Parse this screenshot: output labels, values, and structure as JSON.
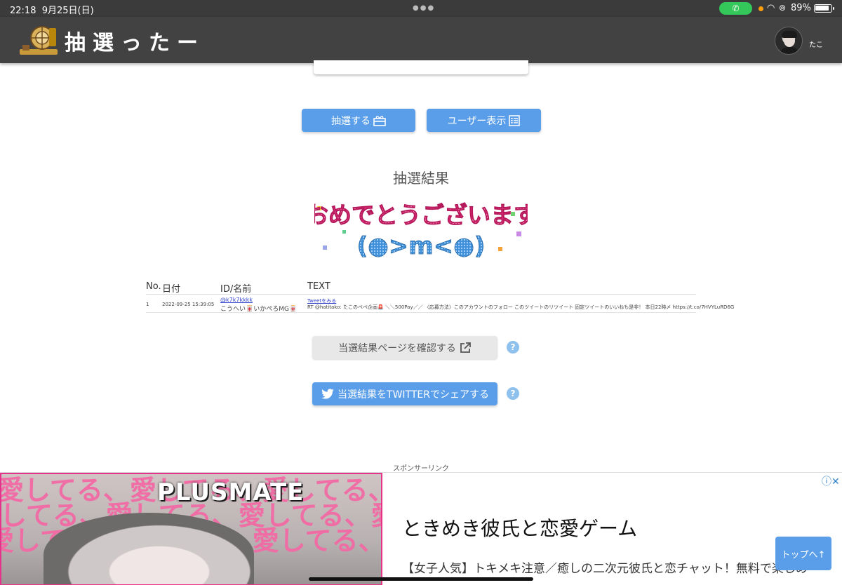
{
  "status_bar": {
    "time": "22:18",
    "date": "9月25日(日)",
    "battery_percent": "89%",
    "battery_level": 0.89,
    "call_icon": "phone-icon",
    "wifi_icon": "wifi-icon"
  },
  "header": {
    "logo_text": "抽選ったー",
    "username": "たこ",
    "bg_color": "#424242"
  },
  "actions": {
    "draw_label": "抽選する",
    "show_users_label": "ユーザー表示",
    "accent_color": "#5a9ee9"
  },
  "result": {
    "title": "抽選結果",
    "congrats_text": "おめでとうございます",
    "congrats_face": "(●>m<●)"
  },
  "table": {
    "headers": {
      "no": "No.",
      "date": "日付",
      "id_name": "ID/名前",
      "text": "TEXT"
    },
    "rows": [
      {
        "no": "1",
        "date": "2022-09-25 15:39:05",
        "id": "@k7k7kkkk",
        "name": "こうへい🀄いかぺろMG🀄",
        "tweet_link": "Tweetをみる",
        "text": "RT @hatitako: たこのペペ企画🚨 ＼＼500Pay／／ 〈応募方法〉このアカウントのフォロー このツイートのリツイート 固定ツイートのいいねも是非！ 本日22時〆 https://t.co/7HVYLuRD6G"
      }
    ]
  },
  "links": {
    "check_page_label": "当選結果ページを確認する",
    "share_label": "当選結果をTWITTERでシェアする",
    "help_mark": "?"
  },
  "sponsor": {
    "label": "スポンサーリンク"
  },
  "ad": {
    "image_brand": "PLUSMATE",
    "image_text": "愛してる、愛してる、愛してる、愛してる、",
    "title": "ときめき彼氏と恋愛ゲーム",
    "description": "【女子人気】トキメキ注意／癒しの二次元彼氏と恋チャット！無料で楽しめ",
    "choices_icon": "ⓘ✕"
  },
  "to_top": {
    "label": "トップへ↑"
  }
}
